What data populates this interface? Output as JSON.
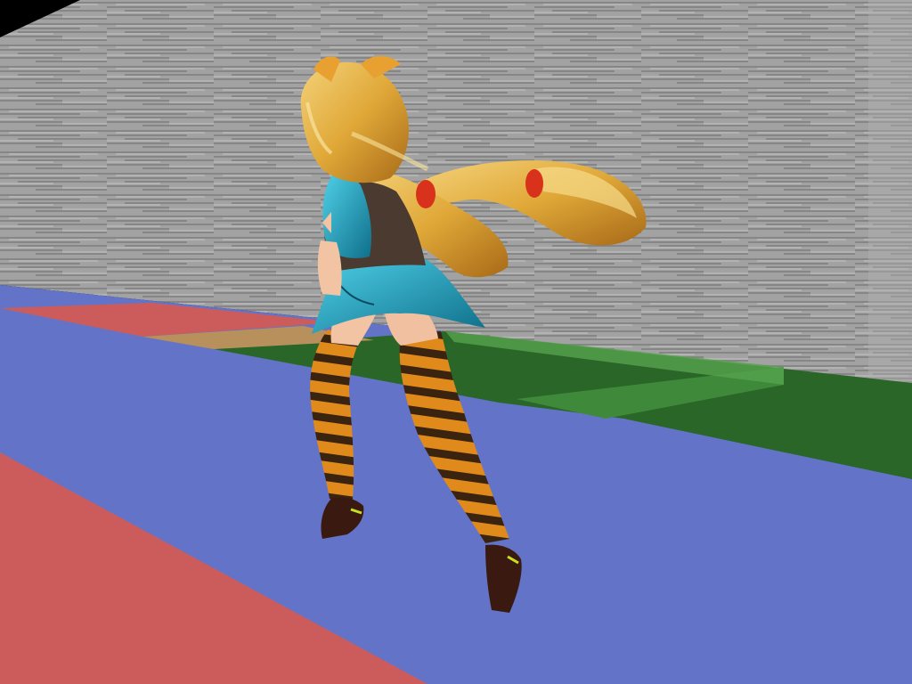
{
  "scene": {
    "wall_texture": "grey-streaked-stone",
    "floor_colors": {
      "blue": "#6374c8",
      "red": "#cc5c5c",
      "green_dark": "#2a6627",
      "green_light": "#3f8a3a",
      "tan": "#b8905c",
      "wall": "#9a9a9a"
    },
    "character": {
      "hair_color": "#e8b84a",
      "outfit_color": "#2aa8c8",
      "stocking_colors": [
        "#e08a1c",
        "#3a2410"
      ]
    }
  }
}
